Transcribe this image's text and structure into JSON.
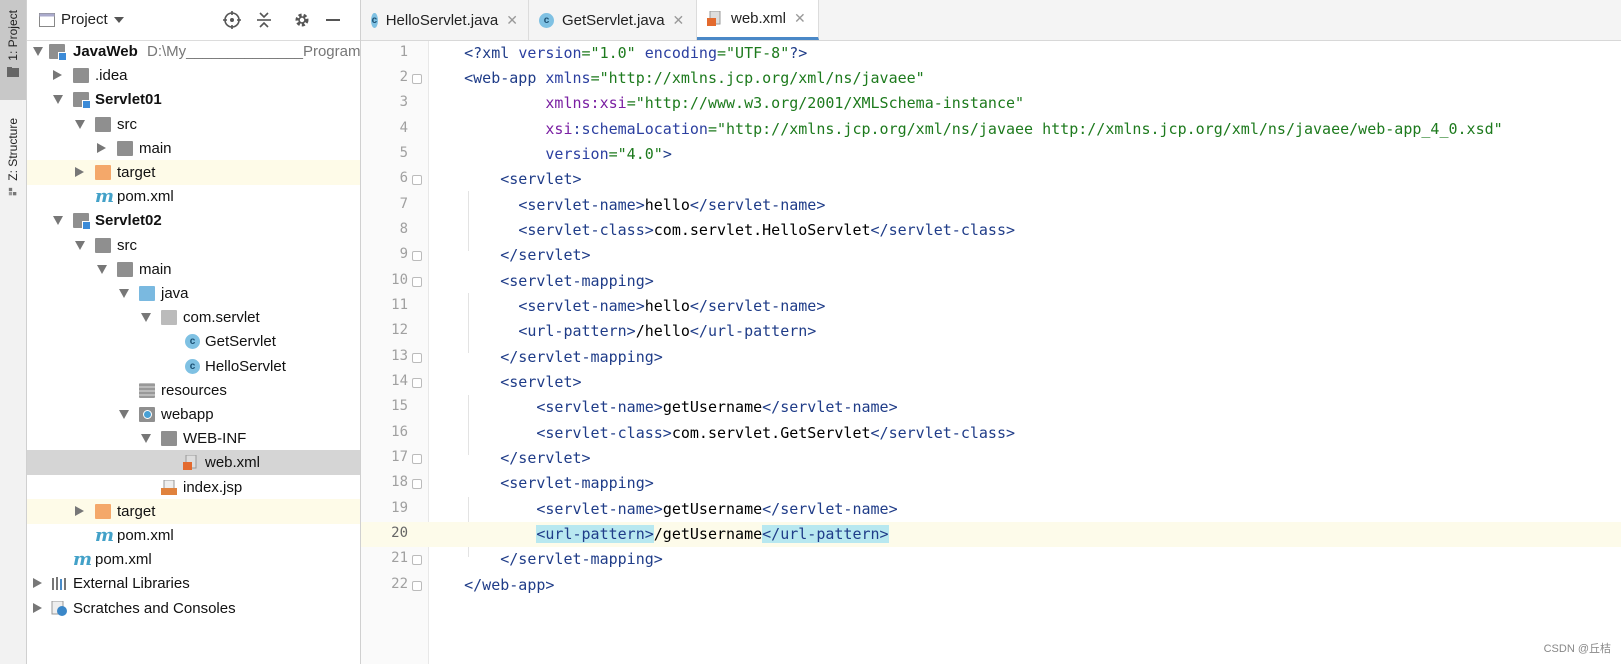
{
  "tool_strip": {
    "project_tab": "1: Project",
    "structure_tab": "Z: Structure"
  },
  "panel": {
    "title": "Project",
    "tree": [
      {
        "label": "JavaWeb",
        "extra": "D:\\My______________Program",
        "bold": true
      },
      {
        "label": ".idea"
      },
      {
        "label": "Servlet01",
        "bold": true
      },
      {
        "label": "src"
      },
      {
        "label": "main"
      },
      {
        "label": "target"
      },
      {
        "label": "pom.xml"
      },
      {
        "label": "Servlet02",
        "bold": true
      },
      {
        "label": "src"
      },
      {
        "label": "main"
      },
      {
        "label": "java"
      },
      {
        "label": "com.servlet"
      },
      {
        "label": "GetServlet"
      },
      {
        "label": "HelloServlet"
      },
      {
        "label": "resources"
      },
      {
        "label": "webapp"
      },
      {
        "label": "WEB-INF"
      },
      {
        "label": "web.xml"
      },
      {
        "label": "index.jsp"
      },
      {
        "label": "target"
      },
      {
        "label": "pom.xml"
      },
      {
        "label": "pom.xml"
      },
      {
        "label": "External Libraries"
      },
      {
        "label": "Scratches and Consoles"
      }
    ]
  },
  "tabs": [
    {
      "label": "HelloServlet.java",
      "icon": "class-icon"
    },
    {
      "label": "GetServlet.java",
      "icon": "class-icon"
    },
    {
      "label": "web.xml",
      "icon": "xml-icon",
      "active": true
    }
  ],
  "editor": {
    "line_numbers": [
      "1",
      "2",
      "3",
      "4",
      "5",
      "6",
      "7",
      "8",
      "9",
      "10",
      "11",
      "12",
      "13",
      "14",
      "15",
      "16",
      "17",
      "18",
      "19",
      "20",
      "21",
      "22"
    ],
    "current_line": 20
  },
  "watermark": "CSDN @丘桔",
  "colors": {
    "tag": "#1f3c88",
    "attr_value": "#1d7a1d",
    "namespace": "#7a1fa2",
    "current_line": "#fdfbea",
    "selection": "#d5d5d5",
    "tag_match": "#b8e8f0"
  }
}
